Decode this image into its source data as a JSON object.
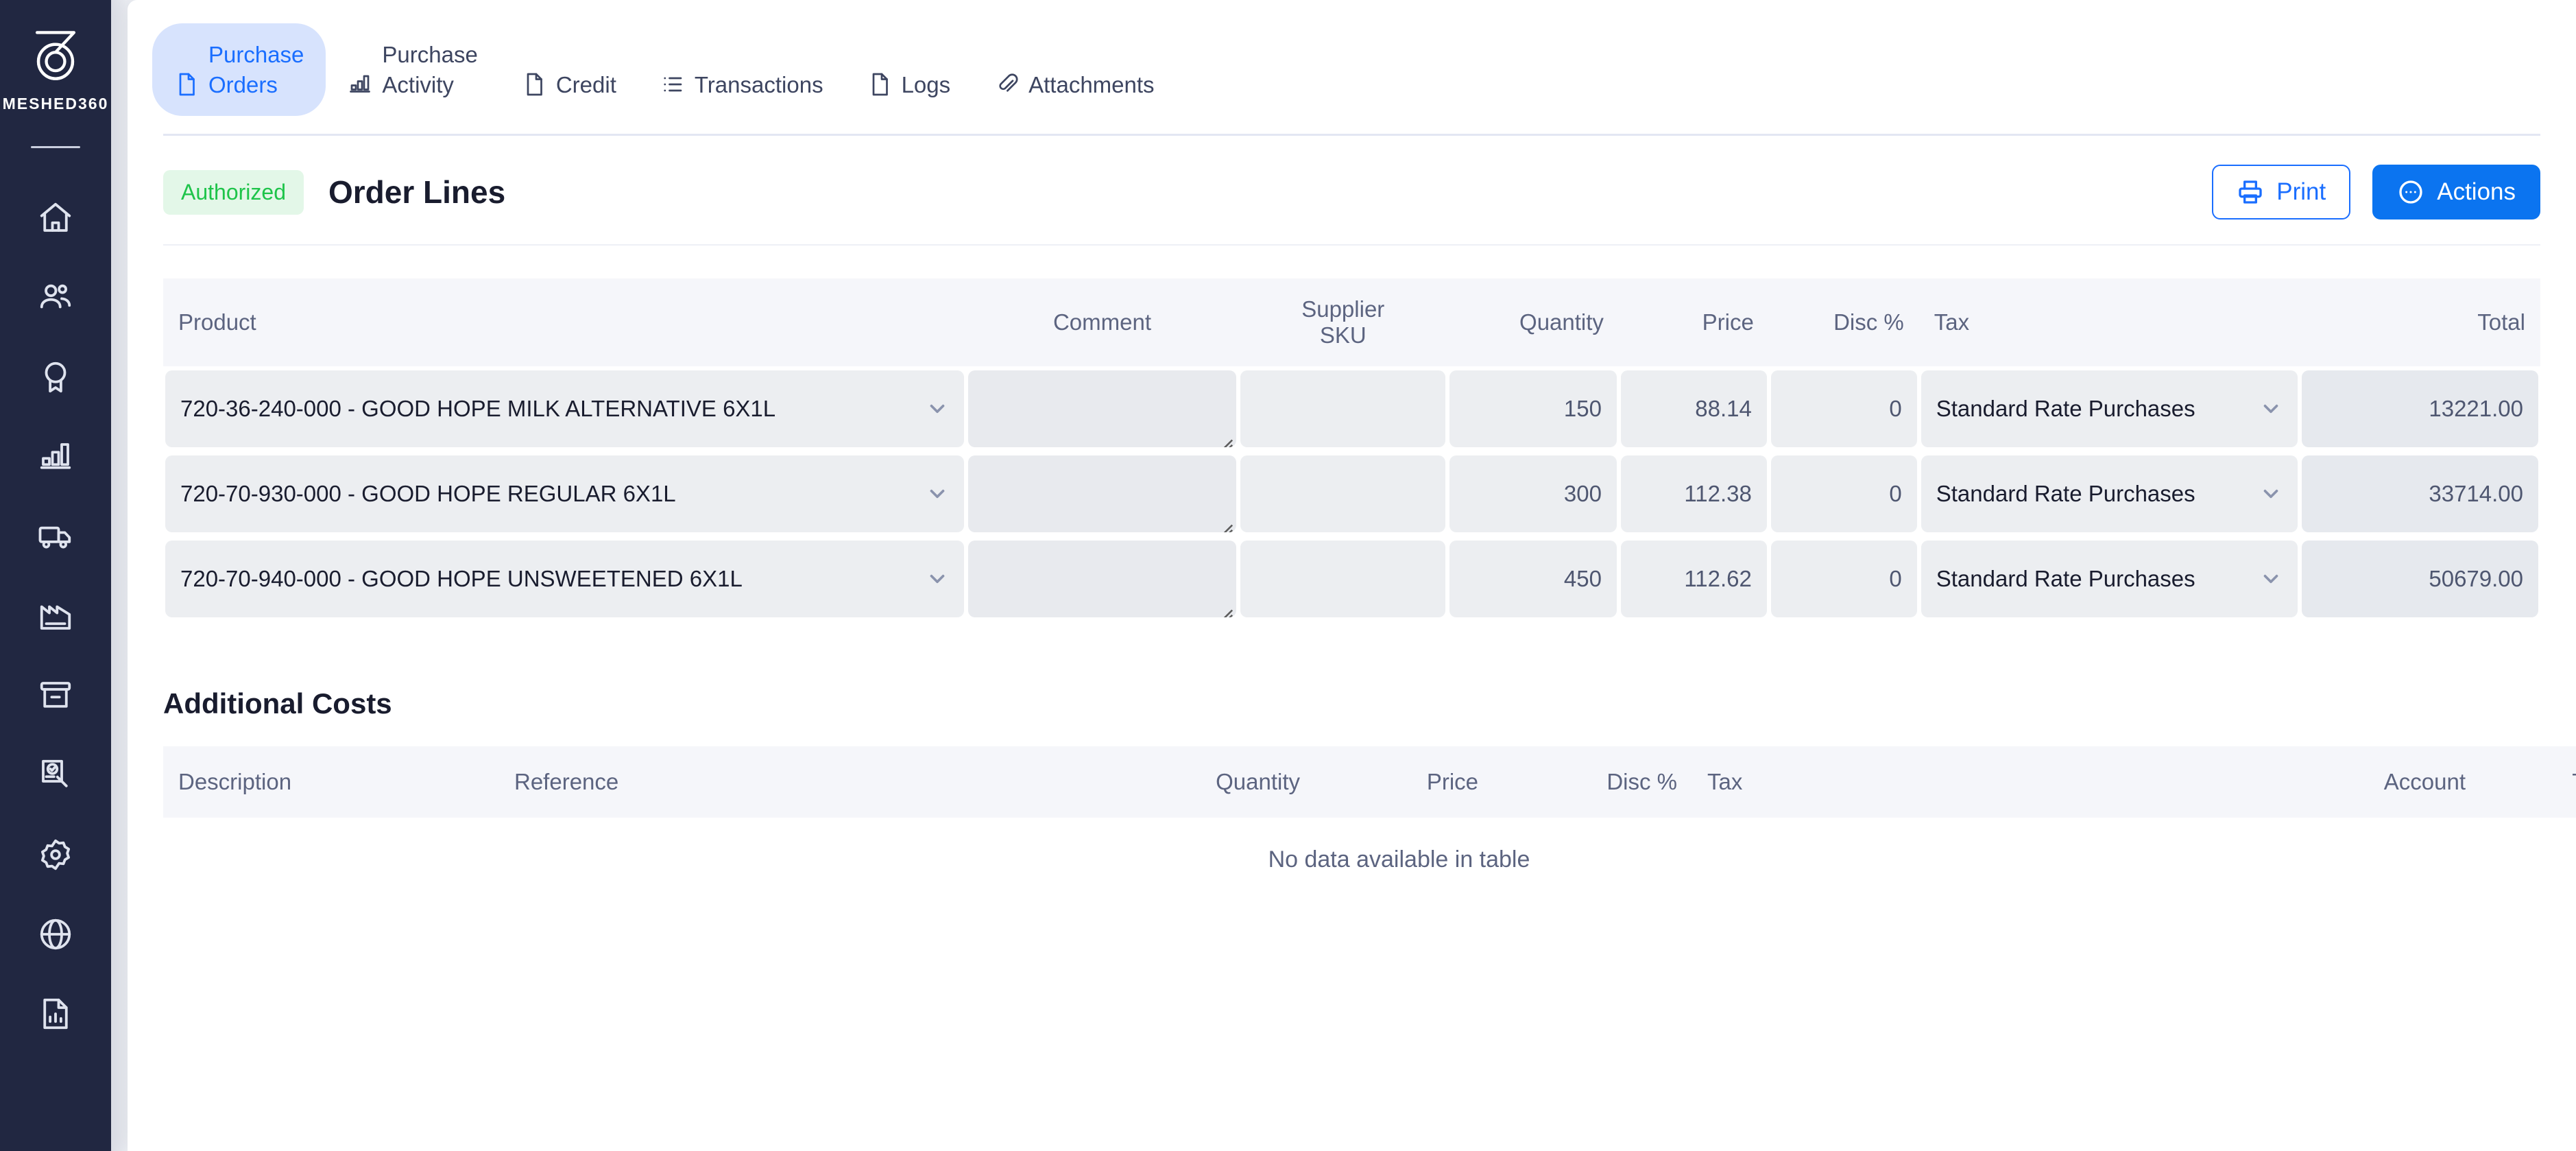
{
  "brand": {
    "name": "MESHED360",
    "logo_icon": "meshed360-spiral-logo"
  },
  "sidebar": {
    "items": [
      {
        "icon": "home-icon",
        "name": "home"
      },
      {
        "icon": "users-icon",
        "name": "contacts"
      },
      {
        "icon": "award-icon",
        "name": "quality"
      },
      {
        "icon": "bar-chart-icon",
        "name": "sales"
      },
      {
        "icon": "truck-icon",
        "name": "logistics"
      },
      {
        "icon": "factory-icon",
        "name": "production"
      },
      {
        "icon": "box-archive-icon",
        "name": "inventory"
      },
      {
        "icon": "document-check-icon",
        "name": "compliance"
      },
      {
        "icon": "gear-icon",
        "name": "settings"
      },
      {
        "icon": "globe-icon",
        "name": "integrations"
      },
      {
        "icon": "report-file-icon",
        "name": "reports"
      }
    ]
  },
  "tabs": [
    {
      "label": "Purchase\nOrders",
      "icon": "file-icon",
      "active": true
    },
    {
      "label": "Purchase\nActivity",
      "icon": "bar-chart-icon",
      "active": false
    },
    {
      "label": "\nCredit",
      "icon": "file-icon",
      "active": false
    },
    {
      "label": "\nTransactions",
      "icon": "list-icon",
      "active": false
    },
    {
      "label": "\nLogs",
      "icon": "file-icon",
      "active": false
    },
    {
      "label": "\nAttachments",
      "icon": "paperclip-icon",
      "active": false
    }
  ],
  "header": {
    "status_badge": "Authorized",
    "title": "Order Lines",
    "print_label": "Print",
    "actions_label": "Actions"
  },
  "colors": {
    "accent_blue": "#0b74f0",
    "tab_active_bg": "#d7e3fd",
    "tab_active_text": "#1a6eff",
    "badge_bg": "#e3f7e8",
    "badge_text": "#1ec44a",
    "sidebar_bg": "#212741",
    "cell_bg": "#eceef1",
    "total_cell_bg": "#e6e9ee",
    "header_row_bg": "#f5f6fa"
  },
  "order_lines": {
    "columns": [
      {
        "label": "Product",
        "align": "left"
      },
      {
        "label": "Comment",
        "align": "center"
      },
      {
        "label": "Supplier\nSKU",
        "align": "center"
      },
      {
        "label": "Quantity",
        "align": "right"
      },
      {
        "label": "Price",
        "align": "right"
      },
      {
        "label": "Disc %",
        "align": "right"
      },
      {
        "label": "Tax",
        "align": "left"
      },
      {
        "label": "Total",
        "align": "right"
      }
    ],
    "rows": [
      {
        "product": "720-36-240-000 - GOOD HOPE MILK ALTERNATIVE 6X1L",
        "comment": "",
        "supplier_sku": "",
        "quantity": "150",
        "price": "88.14",
        "disc": "0",
        "tax": "Standard Rate Purchases",
        "total": "13221.00"
      },
      {
        "product": "720-70-930-000 - GOOD HOPE REGULAR 6X1L",
        "comment": "",
        "supplier_sku": "",
        "quantity": "300",
        "price": "112.38",
        "disc": "0",
        "tax": "Standard Rate Purchases",
        "total": "33714.00"
      },
      {
        "product": "720-70-940-000 - GOOD HOPE UNSWEETENED 6X1L",
        "comment": "",
        "supplier_sku": "",
        "quantity": "450",
        "price": "112.62",
        "disc": "0",
        "tax": "Standard Rate Purchases",
        "total": "50679.00"
      }
    ]
  },
  "additional_costs": {
    "title": "Additional Costs",
    "columns": [
      {
        "label": "Description",
        "align": "left"
      },
      {
        "label": "Reference",
        "align": "left"
      },
      {
        "label": "Quantity",
        "align": "right"
      },
      {
        "label": "Price",
        "align": "right"
      },
      {
        "label": "Disc %",
        "align": "right"
      },
      {
        "label": "Tax",
        "align": "left"
      },
      {
        "label": "Account",
        "align": "right"
      },
      {
        "label": "Total",
        "align": "right"
      }
    ],
    "empty_message": "No data available in table"
  }
}
